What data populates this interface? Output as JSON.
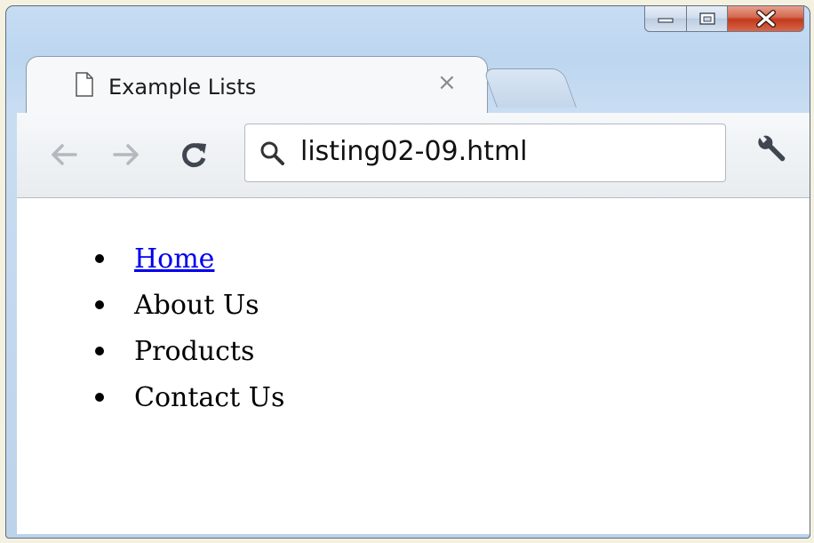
{
  "tab": {
    "title": "Example Lists",
    "close_label": "×",
    "icon": "page-icon"
  },
  "window_controls": {
    "minimize_icon": "minimize-icon",
    "maximize_icon": "maximize-icon",
    "close_icon": "close-icon"
  },
  "toolbar": {
    "back_icon": "back-arrow-icon",
    "forward_icon": "forward-arrow-icon",
    "reload_icon": "reload-icon",
    "omnibox": {
      "value": "listing02-09.html",
      "icon": "search-icon"
    },
    "menu_icon": "wrench-icon"
  },
  "page": {
    "list_items": [
      {
        "label": "Home",
        "is_link": true
      },
      {
        "label": "About Us",
        "is_link": false
      },
      {
        "label": "Products",
        "is_link": false
      },
      {
        "label": "Contact Us",
        "is_link": false
      }
    ],
    "link_color": "#0000ee"
  }
}
